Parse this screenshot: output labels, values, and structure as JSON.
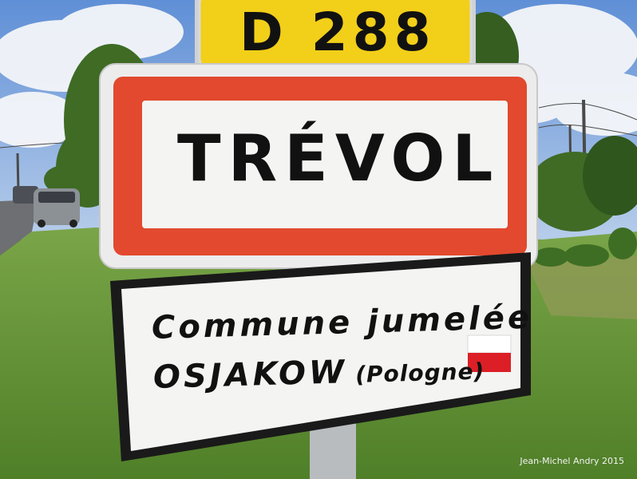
{
  "route_sign": {
    "text": "D 288"
  },
  "town_sign": {
    "name": "TRÉVOL"
  },
  "twin_sign": {
    "line1": "Commune jumelée",
    "city": "OSJAKOW",
    "country": "(Pologne)"
  },
  "flag": {
    "name": "polish-flag-icon",
    "top_color": "#ffffff",
    "bottom_color": "#dc1f26"
  },
  "credit": "Jean-Michel Andry 2015",
  "colors": {
    "sign_border_red": "#e2492e",
    "route_sign_yellow": "#f2cf19",
    "sky": "#7ea6dd",
    "grass": "#6f9a3a"
  }
}
